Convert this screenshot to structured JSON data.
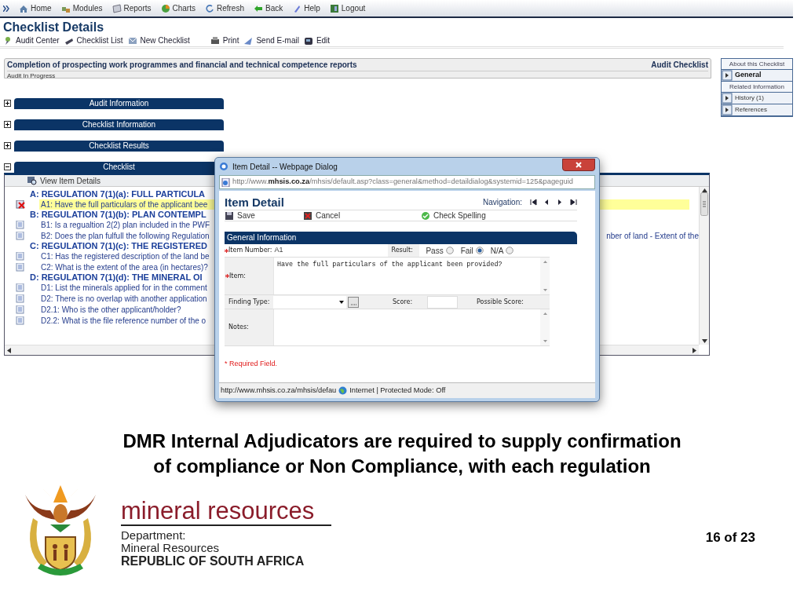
{
  "nav": [
    {
      "label": "Home"
    },
    {
      "label": "Modules"
    },
    {
      "label": "Reports"
    },
    {
      "label": "Charts"
    },
    {
      "label": "Refresh"
    },
    {
      "label": "Back"
    },
    {
      "label": "Help"
    },
    {
      "label": "Logout"
    }
  ],
  "page": {
    "title": "Checklist Details",
    "actions": [
      {
        "label": "Audit Center"
      },
      {
        "label": "Checklist List"
      },
      {
        "label": "New Checklist"
      },
      {
        "label": "Print"
      },
      {
        "label": "Send E-mail"
      },
      {
        "label": "Edit"
      }
    ]
  },
  "audit": {
    "title": "Completion of prospecting work programmes and financial and technical competence reports",
    "type": "Audit Checklist",
    "status": "Audit In Progress"
  },
  "sidebar": {
    "sections": [
      {
        "heading": "About this Checklist",
        "items": [
          {
            "label": "General",
            "selected": true
          }
        ]
      },
      {
        "heading": "Related Information",
        "items": [
          {
            "label": "History (1)",
            "selected": false
          },
          {
            "label": "References",
            "selected": false
          }
        ]
      }
    ]
  },
  "panels": [
    {
      "title": "Audit Information",
      "expanded": false
    },
    {
      "title": "Checklist Information",
      "expanded": false
    },
    {
      "title": "Checklist Results",
      "expanded": false
    },
    {
      "title": "Checklist",
      "expanded": true
    }
  ],
  "checklist": {
    "toolbar": "View Item Details",
    "rows": [
      {
        "kind": "section",
        "text": "A: REGULATION 7(1)(a): FULL PARTICULA"
      },
      {
        "kind": "item",
        "text": "A1: Have the full particulars of the applicant bee",
        "failed": true,
        "selected": true
      },
      {
        "kind": "section",
        "text": "B: REGULATION 7(1)(b): PLAN CONTEMPL"
      },
      {
        "kind": "item",
        "text": "B1: Is a regualtion 2(2) plan included in the PWF",
        "failed": false,
        "selected": false
      },
      {
        "kind": "item",
        "text": "B2: Does the plan fulfull the following Regulation",
        "continuation": "nber of land - Extent of the",
        "failed": false,
        "selected": false
      },
      {
        "kind": "section",
        "text": "C: REGULATION 7(1)(c): THE REGISTERED"
      },
      {
        "kind": "item",
        "text": "C1: Has the registered description of the land be",
        "failed": false,
        "selected": false
      },
      {
        "kind": "item",
        "text": "C2: What is the extent of the area (in hectares)?",
        "failed": false,
        "selected": false
      },
      {
        "kind": "section",
        "text": "D: REGULATION 7(1)(d): THE MINERAL OI"
      },
      {
        "kind": "item",
        "text": "D1: List the minerals applied for in the comment",
        "failed": false,
        "selected": false
      },
      {
        "kind": "item",
        "text": "D2: There is no overlap with another application",
        "failed": false,
        "selected": false
      },
      {
        "kind": "item",
        "text": "D2.1: Who is the other applicant/holder?",
        "failed": false,
        "selected": false
      },
      {
        "kind": "item",
        "text": "D2.2: What is the file reference number of the o",
        "failed": false,
        "selected": false
      }
    ]
  },
  "dialog": {
    "title": "Item Detail -- Webpage Dialog",
    "address": "http://www.**mhsis.co.za**/mhsis/default.asp?class=general&method=detaildialog&systemid=125&pageguid",
    "heading": "Item Detail",
    "navigation_label": "Navigation:",
    "actions": [
      {
        "label": "Save"
      },
      {
        "label": "Cancel"
      },
      {
        "label": "Check Spelling"
      }
    ],
    "section": "General Information",
    "item_number": {
      "label": "Item Number:",
      "value": "A1",
      "required": true
    },
    "result": {
      "label": "Result:",
      "options": [
        {
          "label": "Pass",
          "selected": false
        },
        {
          "label": "Fail",
          "selected": true
        },
        {
          "label": "N/A",
          "selected": false
        }
      ]
    },
    "item": {
      "label": "Item:",
      "value": "Have the full particulars of the applicant been provided?",
      "required": true
    },
    "finding_type": {
      "label": "Finding Type:",
      "required": false
    },
    "score": {
      "label": "Score:"
    },
    "possible_score": {
      "label": "Possible Score:"
    },
    "notes": {
      "label": "Notes:",
      "required": false
    },
    "required_note": "* Required Field.",
    "status_bar": {
      "url": "http://www.mhsis.co.za/mhsis/defau",
      "zone": "Internet | Protected Mode: Off"
    }
  },
  "slide": {
    "caption": "DMR Internal Adjudicators are required to supply confirmation of compliance or Non Compliance, with each regulation",
    "logo": {
      "name": "mineral resources",
      "lines": [
        "Department:",
        "Mineral Resources",
        "REPUBLIC OF SOUTH AFRICA"
      ]
    },
    "page_number": "16 of 23"
  }
}
